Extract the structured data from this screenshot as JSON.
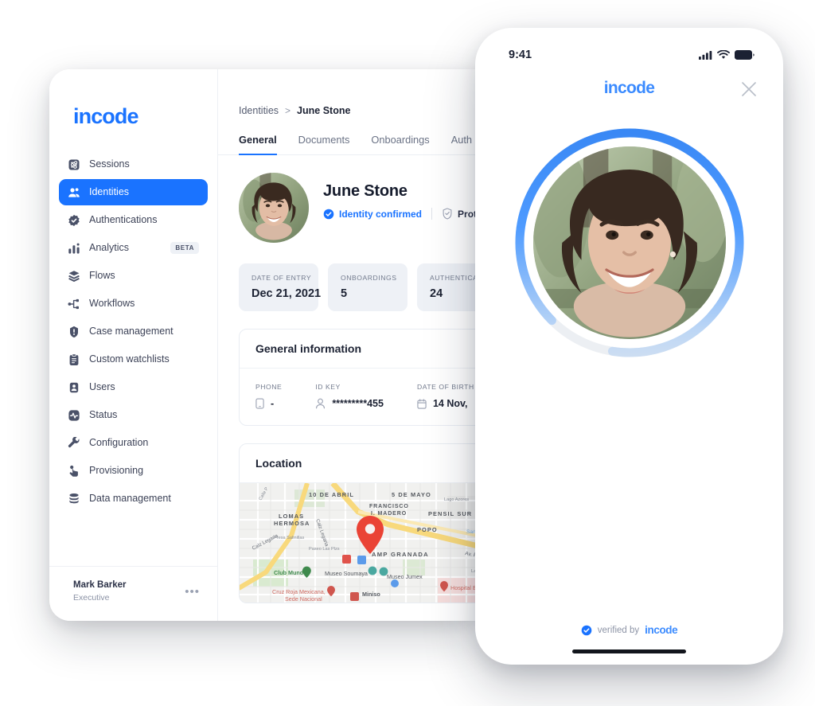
{
  "colors": {
    "brand_blue": "#1a73ff",
    "phone_blue": "#3b8bff",
    "text_dark": "#1c2233",
    "text_muted": "#737b8e",
    "chip_bg": "#eef1f6"
  },
  "desktop": {
    "sidebar": {
      "brand": "incode",
      "items": [
        {
          "label": "Sessions",
          "icon": "sessions-icon",
          "active": false,
          "badge": ""
        },
        {
          "label": "Identities",
          "icon": "identities-icon",
          "active": true,
          "badge": ""
        },
        {
          "label": "Authentications",
          "icon": "authentications-icon",
          "active": false,
          "badge": ""
        },
        {
          "label": "Analytics",
          "icon": "analytics-icon",
          "active": false,
          "badge": "BETA"
        },
        {
          "label": "Flows",
          "icon": "flows-icon",
          "active": false,
          "badge": ""
        },
        {
          "label": "Workflows",
          "icon": "workflows-icon",
          "active": false,
          "badge": ""
        },
        {
          "label": "Case management",
          "icon": "case-management-icon",
          "active": false,
          "badge": ""
        },
        {
          "label": "Custom watchlists",
          "icon": "custom-watchlists-icon",
          "active": false,
          "badge": ""
        },
        {
          "label": "Users",
          "icon": "users-icon",
          "active": false,
          "badge": ""
        },
        {
          "label": "Status",
          "icon": "status-icon",
          "active": false,
          "badge": ""
        },
        {
          "label": "Configuration",
          "icon": "configuration-icon",
          "active": false,
          "badge": ""
        },
        {
          "label": "Provisioning",
          "icon": "provisioning-icon",
          "active": false,
          "badge": ""
        },
        {
          "label": "Data management",
          "icon": "data-management-icon",
          "active": false,
          "badge": ""
        }
      ],
      "footer": {
        "name": "Mark Barker",
        "role": "Executive",
        "menu_glyph": "•••"
      }
    },
    "breadcrumb": {
      "root": "Identities",
      "separator": ">",
      "current": "June Stone"
    },
    "tabs": [
      {
        "label": "General",
        "active": true
      },
      {
        "label": "Documents",
        "active": false
      },
      {
        "label": "Onboardings",
        "active": false
      },
      {
        "label": "Auth",
        "active": false
      }
    ],
    "profile": {
      "name": "June Stone",
      "badge_confirmed": "Identity confirmed",
      "badge_protected": "Prote"
    },
    "stats": [
      {
        "key": "DATE OF ENTRY",
        "value": "Dec 21, 2021"
      },
      {
        "key": "ONBOARDINGS",
        "value": "5"
      },
      {
        "key": "AUTHENTICATION",
        "value": "24"
      }
    ],
    "general_information": {
      "title": "General information",
      "fields": [
        {
          "key": "PHONE",
          "value": "-",
          "icon": "phone-icon"
        },
        {
          "key": "ID KEY",
          "value": "*********455",
          "icon": "person-icon"
        },
        {
          "key": "DATE OF BIRTH",
          "value": "14 Nov,",
          "icon": "calendar-icon"
        }
      ]
    },
    "location": {
      "title": "Location",
      "map_labels": [
        "10 DE ABRIL",
        "5 DE MAYO",
        "FRANCISCO",
        "I. MADERO",
        "PENSIL SUR",
        "LOMAS",
        "HERMOSA",
        "POPO",
        "San Joaq",
        "AMP GRANADA",
        "Calz Legaria",
        "Av. Rio Sa",
        "Club Mundet",
        "Museo Soumaya",
        "Museo Jumex",
        "Cruz Roja Mexicana,",
        "Sede Nacional",
        "Miniso",
        "Hospital Españ",
        "Presa Salinillas",
        "Paseo Las Plzs",
        "Laguna Yuri",
        "Lago Azores",
        "Calle P"
      ]
    }
  },
  "phone": {
    "status_bar": {
      "time": "9:41",
      "cellular_icon": "cellular-signal-icon",
      "wifi_icon": "wifi-icon",
      "battery_icon": "battery-icon"
    },
    "brand": "incode",
    "close_icon": "close-icon",
    "selfie_ring": {
      "progress_percent": 80,
      "ring_color": "#3b8bff",
      "track_color": "#e6e9ee"
    },
    "footer": {
      "verified_badge_icon": "verified-check-icon",
      "verified_text": "verified by",
      "brand": "incode"
    }
  }
}
